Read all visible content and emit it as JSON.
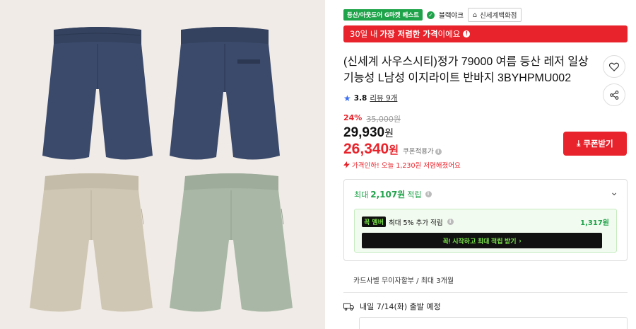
{
  "gallery": {
    "colors": {
      "navy": "#3b4a6b",
      "beige": "#cfc7b4",
      "sage": "#a9b7a6",
      "background": "#f0ebe6"
    }
  },
  "badges": {
    "category": "등산/아웃도어 G마켓 베스트",
    "brand": "블랙야크",
    "store": "신세계백화점"
  },
  "lowest_price_banner": {
    "prefix": "30일 내",
    "highlight": "가장 저렴한 가격",
    "suffix": "이에요"
  },
  "product": {
    "title": "(신세계 사우스시티)정가 79000 여름 등산 레저 일상 기능성 L남성 이지라이트 반바지 3BYHPMU002",
    "rating": "3.8",
    "review_text": "리뷰 9개"
  },
  "price": {
    "discount_pct": "24%",
    "original": "35,000원",
    "sale": "29,930",
    "sale_unit": "원",
    "coupon_price": "26,340",
    "coupon_unit": "원",
    "coupon_label": "쿠폰적용가",
    "price_drop": "가격인하! 오늘 1,230원 저렴해졌어요"
  },
  "coupon_button": {
    "label": "쿠폰받기"
  },
  "points": {
    "prefix": "최대",
    "amount": "2,107원",
    "suffix": "적립",
    "member_tag_1": "꼭",
    "member_tag_2": "멤버",
    "member_text": "최대 5% 추가 적립",
    "member_amount": "1,317원",
    "member_button": "꼭! 시작하고 최대 적립 받기"
  },
  "installment": "카드사별 무이자할부 / 최대 3개월",
  "shipping": "내일 7/14(화) 출발 예정",
  "colors": {
    "accent_red": "#e9232b",
    "accent_green": "#1fa34a",
    "member_green": "#7be34a"
  }
}
